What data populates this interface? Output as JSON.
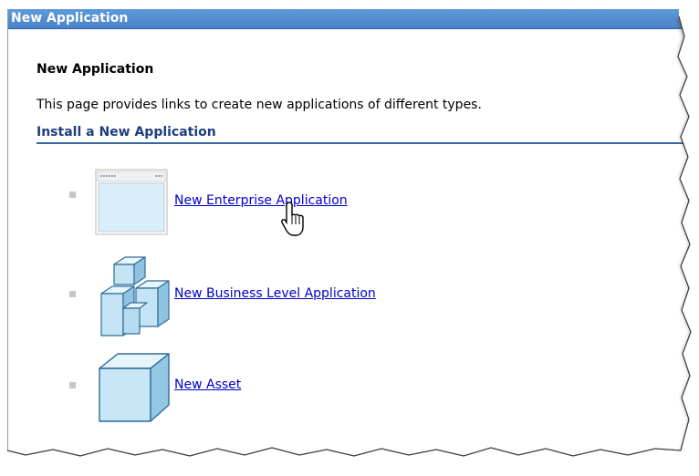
{
  "header": {
    "title": "New Application"
  },
  "main": {
    "section_title": "New Application",
    "description": "This page provides links to create new applications of different types.",
    "install_heading": "Install a New Application",
    "links": [
      {
        "label": " New Enterprise Application",
        "icon": "enterprise-application-window-icon"
      },
      {
        "label": " New Business Level Application",
        "icon": "business-level-cubes-icon"
      },
      {
        "label": " New Asset",
        "icon": "asset-cube-icon"
      }
    ]
  },
  "colors": {
    "titlebar": "#5e9ad8",
    "heading_rule": "#36689f",
    "link": "#0000cc",
    "icon_fill": "#bfe0f2",
    "icon_stroke": "#2f6c98"
  }
}
